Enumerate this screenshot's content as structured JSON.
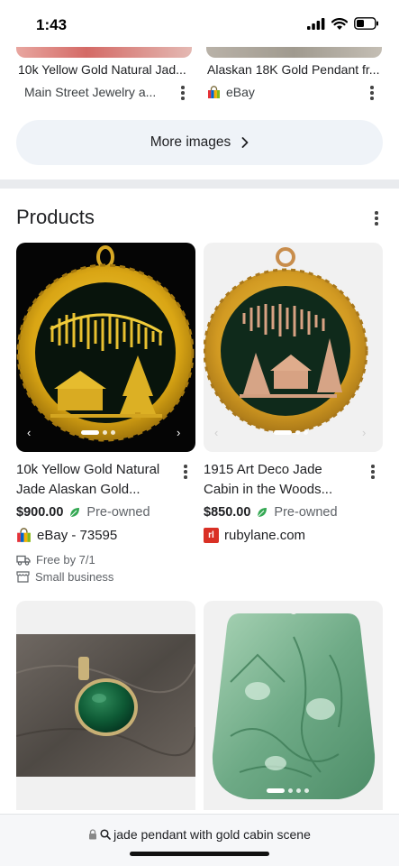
{
  "status_bar": {
    "time": "1:43"
  },
  "image_results": [
    {
      "title": "10k Yellow Gold Natural Jad...",
      "source": "Main Street Jewelry a...",
      "source_icon": "none"
    },
    {
      "title": "Alaskan 18K Gold Pendant fr...",
      "source": "eBay",
      "source_icon": "ebay-bag-icon"
    }
  ],
  "more_images": {
    "label": "More images"
  },
  "products": {
    "section_title": "Products",
    "items": [
      {
        "title": "10k Yellow Gold Natural Jade Alaskan Gold...",
        "price": "$900.00",
        "condition": "Pre-owned",
        "seller": "eBay - 73595",
        "shipping": "Free by 7/1",
        "badge": "Small business"
      },
      {
        "title": "1915 Art Deco Jade Cabin in the Woods...",
        "price": "$850.00",
        "condition": "Pre-owned",
        "seller": "rubylane.com",
        "seller_logo_letter": "rl"
      }
    ]
  },
  "bottom_bar": {
    "url_text": "jade pendant with gold cabin scene"
  },
  "colors": {
    "accent_leaf": "#34a853",
    "rubylane_red": "#d93025",
    "more_images_bg": "#eff3f8"
  }
}
